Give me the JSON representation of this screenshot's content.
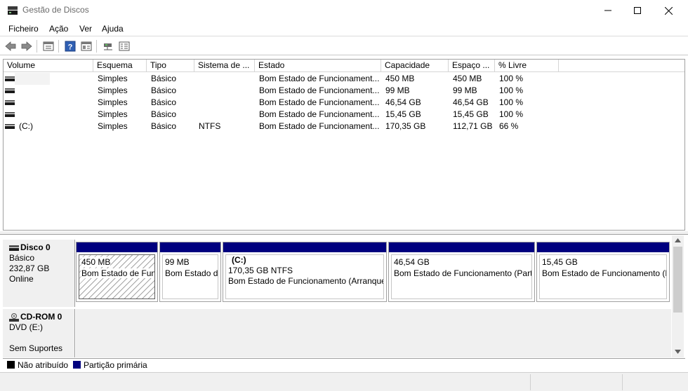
{
  "window": {
    "title": "Gestão de Discos",
    "controls": [
      "minimize-icon",
      "maximize-icon",
      "close-icon"
    ]
  },
  "menu": [
    "Ficheiro",
    "Ação",
    "Ver",
    "Ajuda"
  ],
  "toolbar": {
    "icons": [
      "back-arrow-icon",
      "forward-arrow-icon",
      "properties-icon",
      "help-icon",
      "console-icon",
      "connect-icon",
      "options-icon"
    ]
  },
  "volume_list": {
    "columns": [
      "Volume",
      "Esquema",
      "Tipo",
      "Sistema de ...",
      "Estado",
      "Capacidade",
      "Espaço ...",
      "% Livre"
    ],
    "rows": [
      {
        "volume": "",
        "layout": "Simples",
        "type": "Básico",
        "fs": "",
        "status": "Bom Estado de Funcionament...",
        "capacity": "450 MB",
        "free": "450 MB",
        "pct": "100 %"
      },
      {
        "volume": "",
        "layout": "Simples",
        "type": "Básico",
        "fs": "",
        "status": "Bom Estado de Funcionament...",
        "capacity": "99 MB",
        "free": "99 MB",
        "pct": "100 %"
      },
      {
        "volume": "",
        "layout": "Simples",
        "type": "Básico",
        "fs": "",
        "status": "Bom Estado de Funcionament...",
        "capacity": "46,54 GB",
        "free": "46,54 GB",
        "pct": "100 %"
      },
      {
        "volume": "",
        "layout": "Simples",
        "type": "Básico",
        "fs": "",
        "status": "Bom Estado de Funcionament...",
        "capacity": "15,45 GB",
        "free": "15,45 GB",
        "pct": "100 %"
      },
      {
        "volume": "(C:)",
        "layout": "Simples",
        "type": "Básico",
        "fs": "NTFS",
        "status": "Bom Estado de Funcionament...",
        "capacity": "170,35 GB",
        "free": "112,71 GB",
        "pct": "66 %"
      }
    ]
  },
  "disks": [
    {
      "name": "Disco 0",
      "type": "Básico",
      "size": "232,87 GB",
      "state": "Online",
      "partitions": [
        {
          "name": "",
          "size": "450 MB",
          "status": "Bom Estado de Funcionamento (Partição de Recuperação)"
        },
        {
          "name": "",
          "size": "99 MB",
          "status": "Bom Estado de Funcionamento (Partição de Sistema EFI)"
        },
        {
          "name": "(C:)",
          "size": "170,35 GB NTFS",
          "status": "Bom Estado de Funcionamento (Arranque, Ficheiro de Paginação, Captura de Memória, Partição Primária)"
        },
        {
          "name": "",
          "size": "46,54 GB",
          "status": "Bom Estado de Funcionamento (Partição Primária)"
        },
        {
          "name": "",
          "size": "15,45 GB",
          "status": "Bom Estado de Funcionamento (Partição de Recuperação)"
        }
      ]
    },
    {
      "name": "CD-ROM 0",
      "type": "DVD (E:)",
      "state": "Sem Suportes"
    }
  ],
  "legend": [
    {
      "label": "Não atribuído",
      "color": "#000000"
    },
    {
      "label": "Partição primária",
      "color": "#00007f"
    }
  ]
}
